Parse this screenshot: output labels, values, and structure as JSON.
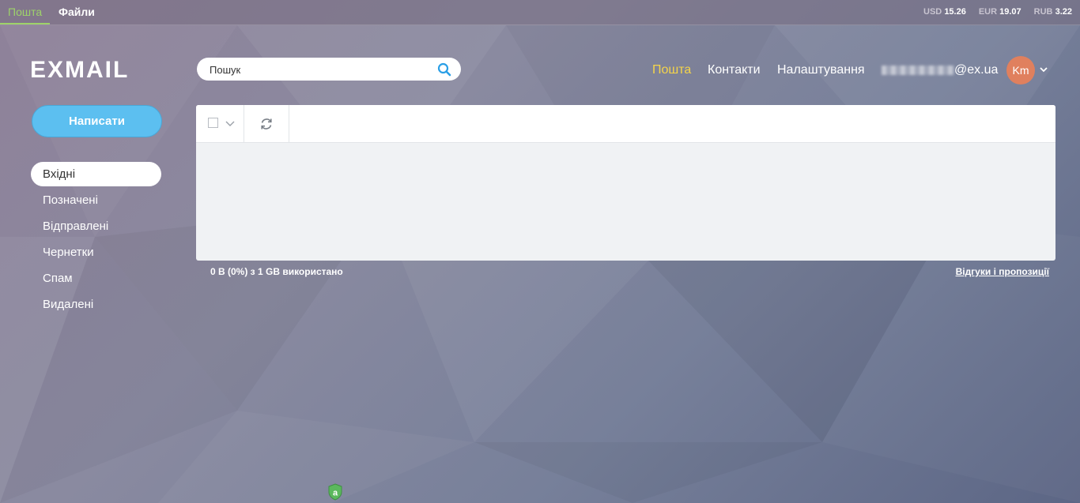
{
  "topbar": {
    "tabs": [
      {
        "label": "Пошта"
      },
      {
        "label": "Файли"
      }
    ],
    "rates": [
      {
        "code": "USD",
        "value": "15.26"
      },
      {
        "code": "EUR",
        "value": "19.07"
      },
      {
        "code": "RUB",
        "value": "3.22"
      }
    ]
  },
  "header": {
    "logo": "EXMAIL",
    "search": {
      "value": "",
      "placeholder": "Пошук"
    },
    "nav": [
      {
        "label": "Пошта"
      },
      {
        "label": "Контакти"
      },
      {
        "label": "Налаштування"
      }
    ],
    "email_domain": "@ex.ua",
    "avatar_initials": "Km"
  },
  "sidebar": {
    "compose_label": "Написати",
    "folders": [
      {
        "label": "Вхідні"
      },
      {
        "label": "Позначені"
      },
      {
        "label": "Відправлені"
      },
      {
        "label": "Чернетки"
      },
      {
        "label": "Спам"
      },
      {
        "label": "Видалені"
      }
    ]
  },
  "footer": {
    "storage": "0 B (0%) з 1 GB використано",
    "feedback": "Відгуки і пропозиції"
  },
  "colors": {
    "accent_green": "#9ed26a",
    "nav_active": "#f4d44a",
    "compose": "#5cbff0",
    "avatar": "#e0805e",
    "search_icon": "#2a9fe6"
  }
}
